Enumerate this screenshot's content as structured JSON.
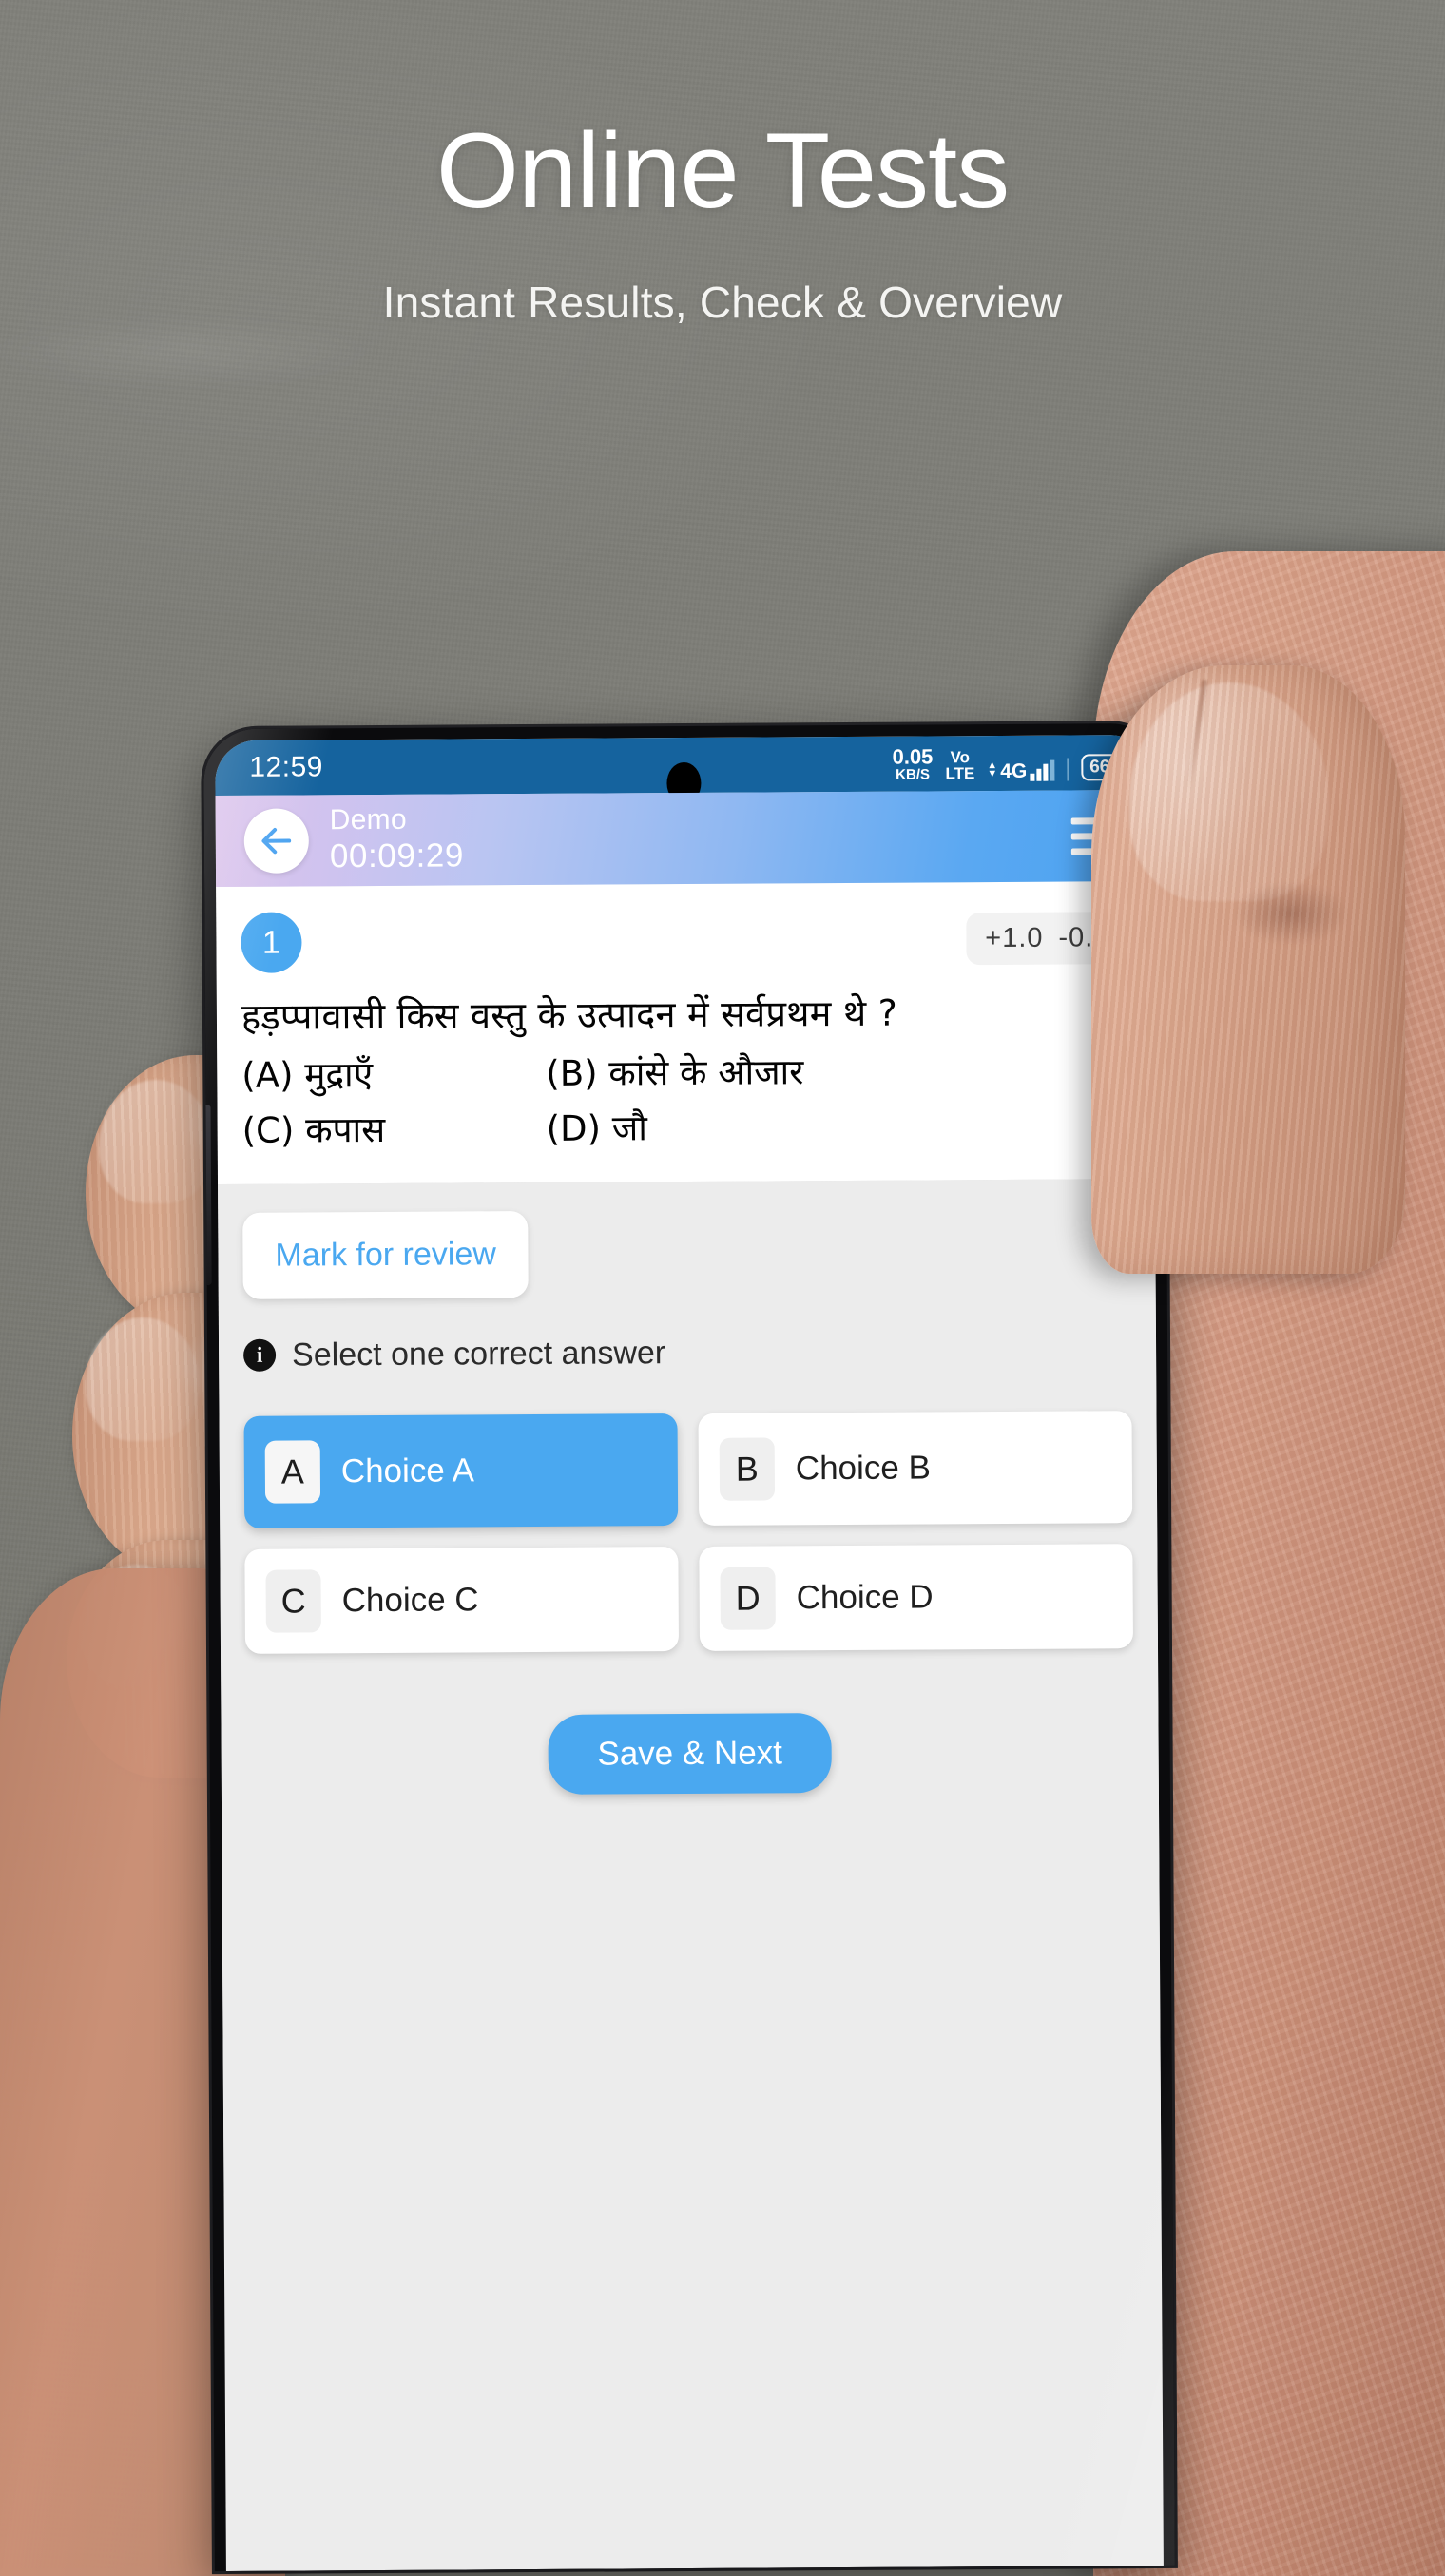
{
  "promo": {
    "headline": "Online Tests",
    "subheadline": "Instant Results, Check & Overview"
  },
  "colors": {
    "accent_blue": "#4aa8f0",
    "statusbar_blue": "#15639e",
    "body_gray": "#ececec",
    "background_wall": "#7c7c76"
  },
  "statusbar": {
    "time": "12:59",
    "net_speed_value": "0.05",
    "net_speed_unit": "KB/S",
    "volte_top": "Vo",
    "volte_bottom": "LTE",
    "network": "4G",
    "battery": "66"
  },
  "appbar": {
    "back_icon": "arrow-left-icon",
    "title": "Demo",
    "timer": "00:09:29",
    "menu_icon": "hamburger-menu-icon"
  },
  "question": {
    "number": "1",
    "marks_positive": "+1.0",
    "marks_negative": "-0.0",
    "text": "हड़प्पावासी किस वस्तु के उत्पादन में सर्वप्रथम थे ?",
    "options": [
      "(A) मुद्राएँ",
      "(B) कांसे के औजार",
      "(C) कपास",
      "(D) जौ"
    ]
  },
  "actions": {
    "mark_for_review": "Mark for review",
    "select_hint": "Select one correct answer",
    "info_icon_glyph": "i",
    "save_next": "Save & Next"
  },
  "choices": [
    {
      "letter": "A",
      "label": "Choice A",
      "selected": true
    },
    {
      "letter": "B",
      "label": "Choice B",
      "selected": false
    },
    {
      "letter": "C",
      "label": "Choice C",
      "selected": false
    },
    {
      "letter": "D",
      "label": "Choice D",
      "selected": false
    }
  ]
}
